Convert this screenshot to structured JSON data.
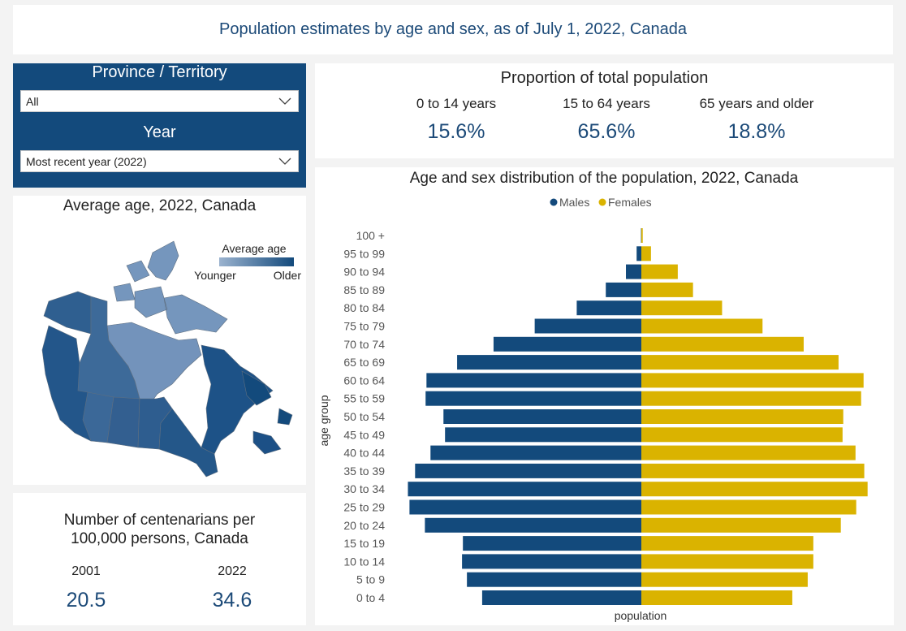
{
  "header": {
    "title": "Population estimates by age and sex, as of July 1, 2022, Canada"
  },
  "filters": {
    "province_label": "Province / Territory",
    "province_value": "All",
    "year_label": "Year",
    "year_value": "Most recent year (2022)"
  },
  "map": {
    "title": "Average age, 2022, Canada",
    "legend_title": "Average age",
    "legend_low": "Younger",
    "legend_high": "Older",
    "color_low": "#9bb3cf",
    "color_high": "#134a7c"
  },
  "centenarians": {
    "title_line1": "Number of centenarians per",
    "title_line2": "100,000 persons, Canada",
    "items": [
      {
        "year": "2001",
        "value": "20.5"
      },
      {
        "year": "2022",
        "value": "34.6"
      }
    ]
  },
  "proportion": {
    "title": "Proportion of total population",
    "items": [
      {
        "label": "0 to 14 years",
        "value": "15.6%"
      },
      {
        "label": "15 to 64 years",
        "value": "65.6%"
      },
      {
        "label": "65 years and older",
        "value": "18.8%"
      }
    ]
  },
  "colors": {
    "males": "#134a7c",
    "females": "#dab300",
    "accent_text": "#1c4a78"
  },
  "chart_data": {
    "type": "bar",
    "orientation": "horizontal-pyramid",
    "title": "Age and sex distribution of the population, 2022, Canada",
    "xlabel": "population",
    "ylabel": "age group",
    "legend": [
      "Males",
      "Females"
    ],
    "legend_position": "top-center",
    "grid": false,
    "categories": [
      "100 +",
      "95 to 99",
      "90 to 94",
      "85 to 89",
      "80 to 84",
      "75 to 79",
      "70 to 74",
      "65 to 69",
      "60 to 64",
      "55 to 59",
      "50 to 54",
      "45 to 49",
      "40 to 44",
      "35 to 39",
      "30 to 34",
      "25 to 29",
      "20 to 24",
      "15 to 19",
      "10 to 14",
      "5 to 9",
      "0 to 4"
    ],
    "series": [
      {
        "name": "Males",
        "values": [
          2000,
          27000,
          88000,
          203000,
          369000,
          609000,
          844000,
          1052000,
          1227000,
          1232000,
          1130000,
          1121000,
          1204000,
          1292000,
          1333000,
          1324000,
          1236000,
          1019000,
          1024000,
          996000,
          909000
        ]
      },
      {
        "name": "Females",
        "values": [
          8000,
          55000,
          208000,
          295000,
          461000,
          692000,
          927000,
          1126000,
          1269000,
          1255000,
          1153000,
          1149000,
          1223000,
          1273000,
          1292000,
          1227000,
          1139000,
          982000,
          982000,
          950000,
          862000
        ]
      }
    ],
    "xlim": [
      -1400000,
      1400000
    ]
  }
}
